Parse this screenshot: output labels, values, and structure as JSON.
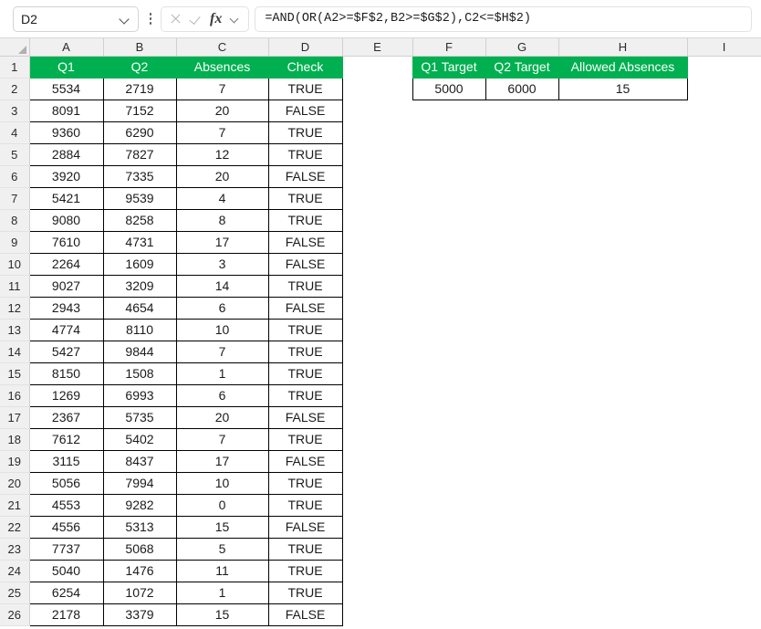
{
  "app": {
    "name_box": {
      "value": "D2",
      "icon": "chevron-down-icon",
      "menu_icon": "kebab-menu-icon"
    },
    "formula_bar": {
      "cancel_icon": "cancel-x-icon",
      "enter_icon": "enter-check-icon",
      "function_icon": "fx-insert-function-icon",
      "dropdown_icon": "chevron-down-icon",
      "value": "=AND(OR(A2>=$F$2,B2>=$G$2),C2<=$H$2)"
    }
  },
  "grid": {
    "column_letters": [
      "A",
      "B",
      "C",
      "D",
      "E",
      "F",
      "G",
      "H",
      "I"
    ],
    "row_numbers": [
      1,
      2,
      3,
      4,
      5,
      6,
      7,
      8,
      9,
      10,
      11,
      12,
      13,
      14,
      15,
      16,
      17,
      18,
      19,
      20,
      21,
      22,
      23,
      24,
      25,
      26
    ],
    "select_all_icon": "select-all-corner-icon",
    "colors": {
      "header_fill": "#00b050",
      "header_text": "#ffffff",
      "grid_border": "#000000",
      "headband": "#f0f0f0"
    }
  },
  "table_main": {
    "headers": [
      "Q1",
      "Q2",
      "Absences",
      "Check"
    ],
    "rows": [
      [
        "5534",
        "2719",
        "7",
        "TRUE"
      ],
      [
        "8091",
        "7152",
        "20",
        "FALSE"
      ],
      [
        "9360",
        "6290",
        "7",
        "TRUE"
      ],
      [
        "2884",
        "7827",
        "12",
        "TRUE"
      ],
      [
        "3920",
        "7335",
        "20",
        "FALSE"
      ],
      [
        "5421",
        "9539",
        "4",
        "TRUE"
      ],
      [
        "9080",
        "8258",
        "8",
        "TRUE"
      ],
      [
        "7610",
        "4731",
        "17",
        "FALSE"
      ],
      [
        "2264",
        "1609",
        "3",
        "FALSE"
      ],
      [
        "9027",
        "3209",
        "14",
        "TRUE"
      ],
      [
        "2943",
        "4654",
        "6",
        "FALSE"
      ],
      [
        "4774",
        "8110",
        "10",
        "TRUE"
      ],
      [
        "5427",
        "9844",
        "7",
        "TRUE"
      ],
      [
        "8150",
        "1508",
        "1",
        "TRUE"
      ],
      [
        "1269",
        "6993",
        "6",
        "TRUE"
      ],
      [
        "2367",
        "5735",
        "20",
        "FALSE"
      ],
      [
        "7612",
        "5402",
        "7",
        "TRUE"
      ],
      [
        "3115",
        "8437",
        "17",
        "FALSE"
      ],
      [
        "5056",
        "7994",
        "10",
        "TRUE"
      ],
      [
        "4553",
        "9282",
        "0",
        "TRUE"
      ],
      [
        "4556",
        "5313",
        "15",
        "FALSE"
      ],
      [
        "7737",
        "5068",
        "5",
        "TRUE"
      ],
      [
        "5040",
        "1476",
        "11",
        "TRUE"
      ],
      [
        "6254",
        "1072",
        "1",
        "TRUE"
      ],
      [
        "2178",
        "3379",
        "15",
        "FALSE"
      ]
    ]
  },
  "table_criteria": {
    "headers": [
      "Q1 Target",
      "Q2 Target",
      "Allowed Absences"
    ],
    "values": [
      "5000",
      "6000",
      "15"
    ]
  }
}
